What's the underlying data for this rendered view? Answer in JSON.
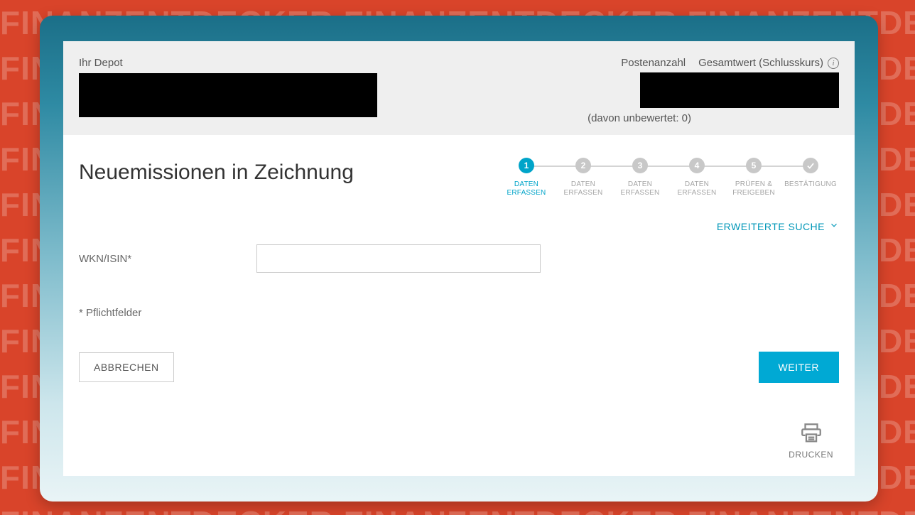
{
  "background_word": "FINANZENTDECKER ",
  "header": {
    "depot_label": "Ihr Depot",
    "posten_label": "Postenanzahl",
    "gesamtwert_label": "Gesamtwert (Schlusskurs)",
    "davon_text": "(davon unbewertet: 0)"
  },
  "page": {
    "title": "Neuemissionen in Zeichnung",
    "advanced_search": "ERWEITERTE SUCHE"
  },
  "stepper": {
    "steps": [
      {
        "num": "1",
        "label": "DATEN\nERFASSEN",
        "active": true
      },
      {
        "num": "2",
        "label": "DATEN\nERFASSEN",
        "active": false
      },
      {
        "num": "3",
        "label": "DATEN\nERFASSEN",
        "active": false
      },
      {
        "num": "4",
        "label": "DATEN\nERFASSEN",
        "active": false
      },
      {
        "num": "5",
        "label": "PRÜFEN &\nFREIGEBEN",
        "active": false
      },
      {
        "num": "check",
        "label": "BESTÄTIGUNG",
        "active": false
      }
    ]
  },
  "form": {
    "wkn_label": "WKN/ISIN*",
    "wkn_value": "",
    "required_note": "* Pflichtfelder"
  },
  "buttons": {
    "cancel": "ABBRECHEN",
    "next": "WEITER",
    "print": "DRUCKEN"
  },
  "colors": {
    "accent": "#00a9d4",
    "bg": "#d9442a"
  }
}
